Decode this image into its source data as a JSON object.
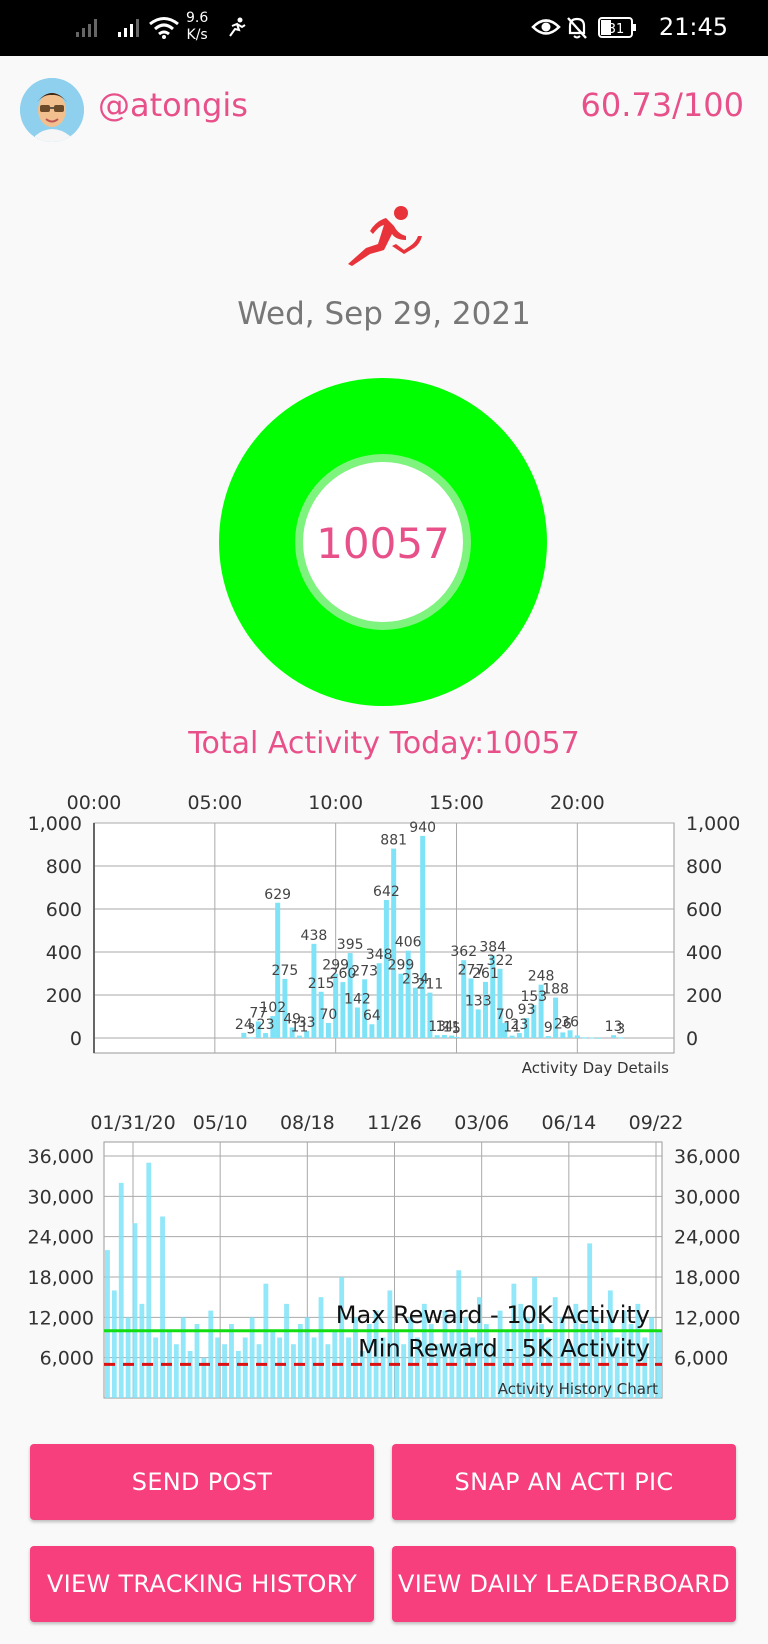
{
  "status_bar": {
    "speed_value": "9.6",
    "speed_unit": "K/s",
    "time": "21:45",
    "battery": "31"
  },
  "header": {
    "username": "@atongis",
    "score": "60.73/100",
    "avatar_icon": "avatar-icon"
  },
  "date": "Wed, Sep 29, 2021",
  "activity_ring": {
    "value": "10057",
    "progress": 1.0,
    "color": "#00ff00"
  },
  "total_label": "Total Activity Today:10057",
  "daily_chart": {
    "x_ticks": [
      "00:00",
      "05:00",
      "10:00",
      "15:00",
      "20:00"
    ],
    "y_ticks": [
      "1,000",
      "800",
      "600",
      "400",
      "200",
      "0"
    ],
    "caption": "Activity Day Details"
  },
  "history_chart": {
    "x_ticks": [
      "01/31/20",
      "05/10",
      "08/18",
      "11/26",
      "03/06",
      "06/14",
      "09/22"
    ],
    "y_ticks": [
      "36,000",
      "30,000",
      "24,000",
      "18,000",
      "12,000",
      "6,000"
    ],
    "max_label": "Max Reward - 10K Activity",
    "min_label": "Min Reward - 5K Activity",
    "caption": "Activity History Chart"
  },
  "chart_data": [
    {
      "type": "bar",
      "x_unit": "hour of day",
      "x": [
        6.2,
        6.5,
        6.8,
        7.1,
        7.4,
        7.6,
        7.9,
        8.2,
        8.5,
        8.8,
        9.1,
        9.4,
        9.7,
        10.0,
        10.3,
        10.6,
        10.9,
        11.2,
        11.5,
        11.8,
        12.1,
        12.4,
        12.7,
        13.0,
        13.3,
        13.6,
        13.9,
        14.2,
        14.5,
        14.8,
        15.0,
        15.3,
        15.6,
        15.9,
        16.2,
        16.5,
        16.8,
        17.0,
        17.3,
        17.6,
        17.9,
        18.2,
        18.5,
        18.8,
        19.1,
        19.4,
        19.7,
        20.0,
        20.3,
        20.6,
        20.9,
        21.5,
        21.8
      ],
      "values": [
        24,
        3,
        77,
        23,
        102,
        629,
        275,
        49,
        11,
        33,
        438,
        215,
        70,
        299,
        260,
        395,
        142,
        273,
        64,
        348,
        642,
        881,
        299,
        406,
        234,
        940,
        211,
        13,
        14,
        11,
        5,
        362,
        277,
        133,
        261,
        384,
        322,
        70,
        11,
        23,
        93,
        153,
        248,
        9,
        188,
        26,
        36,
        12,
        3,
        2,
        1,
        13,
        3
      ],
      "bar_labels": [
        "24",
        "3",
        "77",
        "23",
        "102",
        "629",
        "275",
        "49",
        "11",
        "33",
        "438",
        "215",
        "70",
        "299",
        "260",
        "395",
        "142",
        "273",
        "64",
        "348",
        "642",
        "881",
        "299",
        "406",
        "234",
        "940",
        "211",
        "13",
        "14",
        "11",
        "5",
        "362",
        "277",
        "133",
        "261",
        "384",
        "322",
        "70",
        "11",
        "23",
        "93",
        "153",
        "248",
        "9",
        "188",
        "26",
        "36",
        "",
        "",
        "",
        "",
        "13",
        "3"
      ],
      "xlim": [
        0,
        24
      ],
      "ylim": [
        0,
        1000
      ],
      "grid": true,
      "bar_color": "#7fe3f7"
    },
    {
      "type": "bar",
      "x_unit": "date",
      "x_range": [
        "01/31/20",
        "09/29/21"
      ],
      "values": [
        22000,
        16000,
        32000,
        12000,
        26000,
        14000,
        35000,
        9000,
        27000,
        10000,
        8000,
        12000,
        7000,
        11000,
        6000,
        13000,
        9000,
        8000,
        11000,
        7000,
        9000,
        12000,
        8000,
        17000,
        10000,
        9000,
        14000,
        8000,
        11000,
        12000,
        9000,
        15000,
        8000,
        10000,
        18000,
        9000,
        12000,
        7000,
        11000,
        13000,
        9000,
        16000,
        10000,
        8000,
        12000,
        9000,
        14000,
        11000,
        8000,
        13000,
        10000,
        19000,
        12000,
        9000,
        15000,
        11000,
        8000,
        13000,
        10000,
        17000,
        14000,
        12000,
        18000,
        11000,
        9000,
        15000,
        12000,
        8000,
        14000,
        11000,
        23000,
        12000,
        10000,
        16000,
        9000,
        13000,
        11000,
        14000,
        9000,
        12000,
        10000
      ],
      "ylim": [
        0,
        36000
      ],
      "max_reward": 10000,
      "min_reward": 5000,
      "grid": true,
      "bar_color": "#7fe3f7",
      "max_line_color": "#11dd11",
      "min_line_color": "#dd1111"
    }
  ],
  "buttons": {
    "send_post": "SEND POST",
    "snap_pic": "SNAP AN ACTI PIC",
    "view_history": "VIEW TRACKING HISTORY",
    "view_leaderboard": "VIEW DAILY LEADERBOARD"
  },
  "colors": {
    "accent": "#e8508a",
    "button": "#f63f7c",
    "ring": "#00ff00",
    "bar": "#7fe3f7"
  }
}
